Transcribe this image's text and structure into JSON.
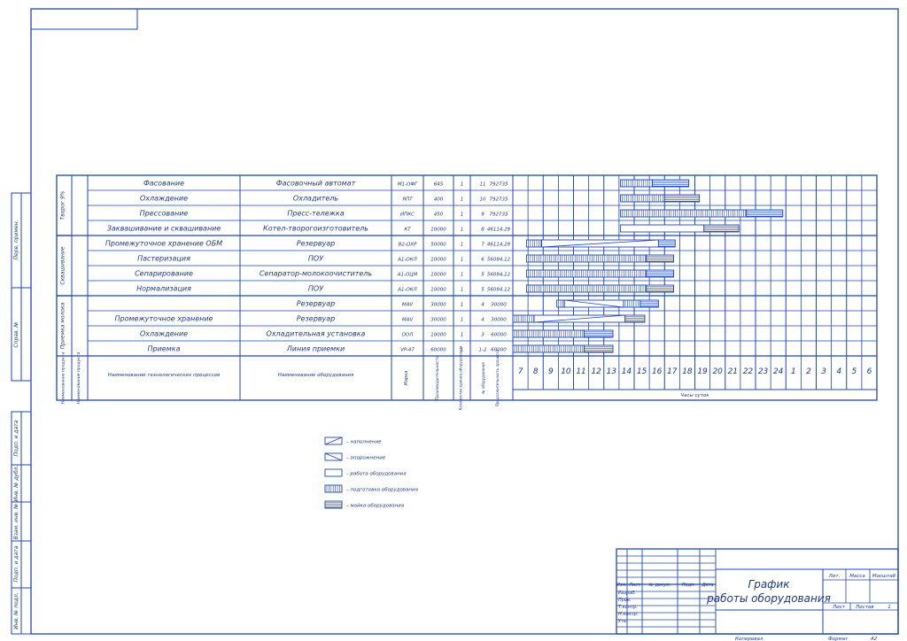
{
  "colors": {
    "ink": "#1f46b5",
    "text": "#1d3a8a",
    "paper": "#ffffff"
  },
  "side_stamps": {
    "top": [
      "Перв. примен.",
      "Справ. №"
    ],
    "bottom": [
      "Подп. и дата",
      "Инв. № дубл.",
      "Взам. инв. №",
      "Подп. и дата",
      "Инв. № подл."
    ]
  },
  "groups": [
    "Творог 9%",
    "Сквашивание",
    "Приемка молока"
  ],
  "rows": [
    {
      "process": "Фасование",
      "equipment": "Фасовочный автомат",
      "mark": "М1-ОФГ",
      "capacity": "645",
      "qty": "1",
      "no": "11",
      "dur": "792735"
    },
    {
      "process": "Охлаждение",
      "equipment": "Охладитель",
      "mark": "ЯПТ",
      "capacity": "400",
      "qty": "1",
      "no": "10",
      "dur": "792735"
    },
    {
      "process": "Прессование",
      "equipment": "Пресс-тележка",
      "mark": "ИПКС",
      "capacity": "450",
      "qty": "1",
      "no": "9",
      "dur": "792735"
    },
    {
      "process": "Заквашивание и сквашивание",
      "equipment": "Котел-творогоизготовитель",
      "mark": "КТ",
      "capacity": "10000",
      "qty": "1",
      "no": "8",
      "dur": "46114,29"
    },
    {
      "process": "Промежуточное хранение ОБМ",
      "equipment": "Резервуар",
      "mark": "В2-ОХР",
      "capacity": "50000",
      "qty": "1",
      "no": "7",
      "dur": "46114,29"
    },
    {
      "process": "Пастеризация",
      "equipment": "ПОУ",
      "mark": "А1-ОКЛ",
      "capacity": "10000",
      "qty": "1",
      "no": "6",
      "dur": "56094,12"
    },
    {
      "process": "Сепарирование",
      "equipment": "Сепаратор-молокоочиститель",
      "mark": "А1-ОЦМ",
      "capacity": "10000",
      "qty": "1",
      "no": "5",
      "dur": "56094,12"
    },
    {
      "process": "Нормализация",
      "equipment": "ПОУ",
      "mark": "А1-ОКЛ",
      "capacity": "10000",
      "qty": "1",
      "no": "5",
      "dur": "56094,12"
    },
    {
      "process": "",
      "equipment": "Резервуар",
      "mark": "МАV",
      "capacity": "30000",
      "qty": "1",
      "no": "4",
      "dur": "30000"
    },
    {
      "process": "Промежуточное хранение",
      "equipment": "Резервуар",
      "mark": "МАV",
      "capacity": "30000",
      "qty": "1",
      "no": "4",
      "dur": "30000"
    },
    {
      "process": "Охлаждение",
      "equipment": "Охладительная установка",
      "mark": "ООЛ",
      "capacity": "10000",
      "qty": "1",
      "no": "3",
      "dur": "60000"
    },
    {
      "process": "Приемка",
      "equipment": "Линия приемки",
      "mark": "VP-47",
      "capacity": "60000",
      "qty": "1",
      "no": "1-2",
      "dur": "60000"
    }
  ],
  "header": {
    "col_group": "Наименование продукта",
    "col_process": "Наименование технологических процессов",
    "col_equipment": "Наименование оборудования",
    "col_mark": "Марка",
    "col_capacity": "Производительность",
    "col_qty": "Количество единиц оборудования",
    "col_no": "№ оборудования",
    "col_dur": "Продолжительность процесса",
    "hours_caption": "Часы суток",
    "hours": [
      "7",
      "8",
      "9",
      "10",
      "11",
      "12",
      "13",
      "14",
      "15",
      "16",
      "17",
      "18",
      "19",
      "20",
      "21",
      "22",
      "23",
      "24",
      "1",
      "2",
      "3",
      "4",
      "5",
      "6"
    ]
  },
  "legend": [
    {
      "type": "fill",
      "label": "– наполнение"
    },
    {
      "type": "empty",
      "label": "– опорожнение"
    },
    {
      "type": "work",
      "label": "– работа оборудования"
    },
    {
      "type": "prep",
      "label": "– подготовка оборудования"
    },
    {
      "type": "wash",
      "label": "– мойка оборудования"
    }
  ],
  "schedule": [
    {
      "segs": [
        [
          14.1,
          16.2,
          "prep"
        ],
        [
          16.2,
          18.6,
          "wash"
        ]
      ]
    },
    {
      "segs": [
        [
          14.1,
          17.0,
          "prep"
        ],
        [
          17.0,
          19.3,
          "wash"
        ]
      ]
    },
    {
      "segs": [
        [
          14.1,
          22.4,
          "prep"
        ],
        [
          22.4,
          24.8,
          "wash"
        ]
      ]
    },
    {
      "segs": [
        [
          14.1,
          19.6,
          "work"
        ],
        [
          19.6,
          21.9,
          "wash"
        ]
      ]
    },
    {
      "segs": [
        [
          7.9,
          8.9,
          "prep"
        ],
        [
          8.9,
          16.6,
          "fill"
        ],
        [
          16.6,
          17.7,
          "wash"
        ]
      ]
    },
    {
      "segs": [
        [
          7.9,
          15.8,
          "prep"
        ],
        [
          15.8,
          17.6,
          "wash"
        ]
      ]
    },
    {
      "segs": [
        [
          7.9,
          15.8,
          "prep"
        ],
        [
          15.8,
          17.6,
          "wash"
        ]
      ]
    },
    {
      "segs": [
        [
          7.9,
          15.8,
          "prep"
        ],
        [
          15.8,
          17.6,
          "wash"
        ]
      ]
    },
    {
      "segs": [
        [
          9.9,
          10.4,
          "prep"
        ],
        [
          10.4,
          14.3,
          "empty"
        ],
        [
          14.3,
          15.4,
          "prep"
        ],
        [
          15.4,
          16.6,
          "wash"
        ]
      ]
    },
    {
      "segs": [
        [
          7.0,
          8.4,
          "prep"
        ],
        [
          8.4,
          14.4,
          "fill"
        ],
        [
          14.4,
          15.7,
          "wash"
        ]
      ]
    },
    {
      "segs": [
        [
          7.0,
          11.7,
          "prep"
        ],
        [
          11.7,
          13.6,
          "wash"
        ]
      ]
    },
    {
      "segs": [
        [
          7.0,
          11.7,
          "prep"
        ],
        [
          11.7,
          13.6,
          "wash"
        ]
      ]
    }
  ],
  "title_block": {
    "title": "График работы оборудования",
    "cols": [
      "Изм.",
      "Лист",
      "№ докум.",
      "Подп.",
      "Дата"
    ],
    "roles": [
      "Разраб.",
      "Пров.",
      "Т.контр.",
      "Н.контр.",
      "Утв."
    ],
    "lit": "Лит.",
    "mass": "Масса",
    "scale": "Масштаб",
    "sheet": "Лист",
    "sheets": "Листов",
    "sheets_n": "1"
  },
  "footer": {
    "copied": "Копировал",
    "format": "Формат",
    "format_val": "А2"
  }
}
